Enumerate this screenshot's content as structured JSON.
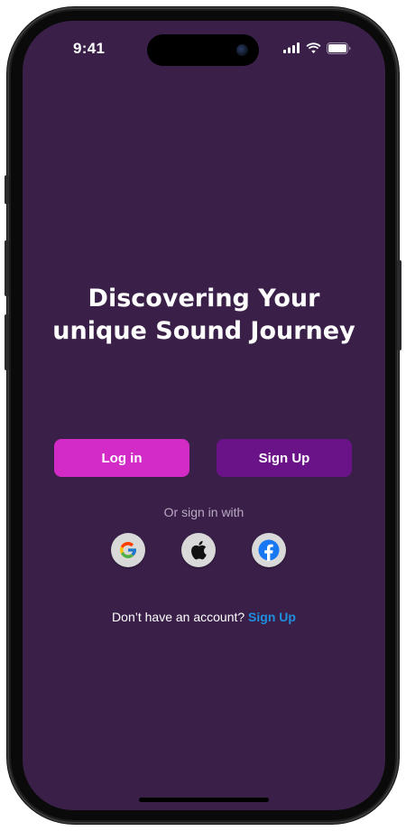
{
  "status_bar": {
    "time": "9:41"
  },
  "headline": {
    "line1": "Discovering Your",
    "line2": "unique Sound Journey"
  },
  "actions": {
    "login_label": "Log in",
    "signup_label": "Sign Up"
  },
  "social": {
    "caption": "Or sign in with",
    "providers": [
      {
        "name": "Google",
        "icon": "google-icon"
      },
      {
        "name": "Apple",
        "icon": "apple-icon"
      },
      {
        "name": "Facebook",
        "icon": "facebook-icon"
      }
    ]
  },
  "footer": {
    "prompt": "Don’t have an account?",
    "link_label": "Sign Up"
  },
  "colors": {
    "background": "#3a2049",
    "login_button": "#d22bc6",
    "signup_button": "#6a1287",
    "link": "#1f8fe0"
  }
}
